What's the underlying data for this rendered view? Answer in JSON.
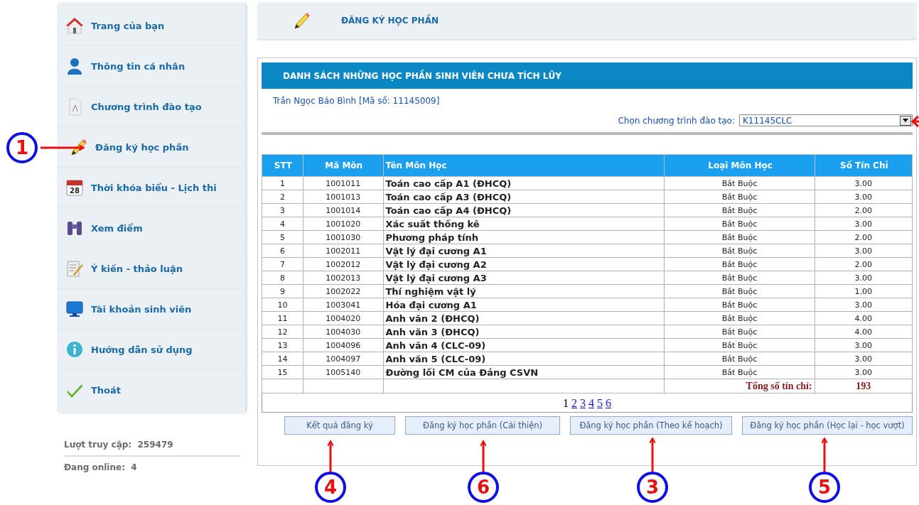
{
  "sidebar": {
    "items": [
      {
        "label": "Trang của bạn",
        "kind": "home"
      },
      {
        "label": "Thông tin cá nhân",
        "kind": "user"
      },
      {
        "label": "Chương trình đào tạo",
        "kind": "document"
      },
      {
        "label": "Đăng ký học phần",
        "kind": "pencil"
      },
      {
        "label": "Thời khóa biểu - Lịch thi",
        "kind": "calendar",
        "icon_text": "28"
      },
      {
        "label": "Xem điểm",
        "kind": "binoculars"
      },
      {
        "label": "Ý kiến - thảo luận",
        "kind": "notes"
      },
      {
        "label": "Tài khoản sinh viên",
        "kind": "monitor"
      },
      {
        "label": "Hướng dẫn sử dụng",
        "kind": "info"
      },
      {
        "label": "Thoát",
        "kind": "check"
      }
    ],
    "stats": [
      {
        "label": "Lượt truy cập:",
        "value": "259479"
      },
      {
        "label": "Đang online:",
        "value": "4"
      }
    ]
  },
  "page_header": {
    "title": "ĐĂNG KÝ HỌC PHẦN"
  },
  "panel": {
    "title": "DANH SÁCH NHỮNG HỌC PHẦN SINH VIÊN CHƯA TÍCH LŨY",
    "student": "Trần Ngọc Bảo Bình [Mã số: 11145009]",
    "program_select": {
      "label": "Chọn chương trình đào tạo:",
      "value": "K11145CLC"
    },
    "table": {
      "columns": [
        "STT",
        "Mã Môn",
        "Tên Môn Học",
        "Loại Môn Học",
        "Số Tín Chỉ"
      ],
      "rows": [
        [
          "1",
          "1001011",
          "Toán cao cấp A1 (ĐHCQ)",
          "Bắt Buộc",
          "3.00"
        ],
        [
          "2",
          "1001013",
          "Toán cao cấp A3 (ĐHCQ)",
          "Bắt Buộc",
          "3.00"
        ],
        [
          "3",
          "1001014",
          "Toán cao cấp A4 (ĐHCQ)",
          "Bắt Buộc",
          "2.00"
        ],
        [
          "4",
          "1001020",
          "Xác suất thống kê",
          "Bắt Buộc",
          "3.00"
        ],
        [
          "5",
          "1001030",
          "Phương pháp tính",
          "Bắt Buộc",
          "2.00"
        ],
        [
          "6",
          "1002011",
          "Vật lý đại cương A1",
          "Bắt Buộc",
          "3.00"
        ],
        [
          "7",
          "1002012",
          "Vật lý đại cương A2",
          "Bắt Buộc",
          "2.00"
        ],
        [
          "8",
          "1002013",
          "Vật lý đại cương A3",
          "Bắt Buộc",
          "3.00"
        ],
        [
          "9",
          "1002022",
          "Thí nghiệm vật lý",
          "Bắt Buộc",
          "1.00"
        ],
        [
          "10",
          "1003041",
          "Hóa đại cương A1",
          "Bắt Buộc",
          "3.00"
        ],
        [
          "11",
          "1004020",
          "Anh văn 2 (ĐHCQ)",
          "Bắt Buộc",
          "4.00"
        ],
        [
          "12",
          "1004030",
          "Anh văn 3 (ĐHCQ)",
          "Bắt Buộc",
          "4.00"
        ],
        [
          "13",
          "1004096",
          "Anh văn 4 (CLC-09)",
          "Bắt Buộc",
          "3.00"
        ],
        [
          "14",
          "1004097",
          "Anh văn 5 (CLC-09)",
          "Bắt Buộc",
          "3.00"
        ],
        [
          "15",
          "1005140",
          "Đường lối CM của Đảng CSVN",
          "Bắt Buộc",
          "3.00"
        ]
      ],
      "total": {
        "label": "Tổng số tín chỉ:",
        "value": "193"
      }
    },
    "pages": [
      {
        "label": "1",
        "selected": true
      },
      {
        "label": "2",
        "selected": false
      },
      {
        "label": "3",
        "selected": false
      },
      {
        "label": "4",
        "selected": false
      },
      {
        "label": "5",
        "selected": false
      },
      {
        "label": "6",
        "selected": false
      }
    ],
    "buttons": [
      "Kết quả đăng ký",
      "Đăng ký học phần (Cải thiện)",
      "Đăng ký học phần (Theo kế hoạch)",
      "Đăng ký học phần (Học lại - học vượt)"
    ]
  },
  "annotations": [
    {
      "label": "1"
    },
    {
      "label": "4"
    },
    {
      "label": "6"
    },
    {
      "label": "3"
    },
    {
      "label": "5"
    }
  ]
}
